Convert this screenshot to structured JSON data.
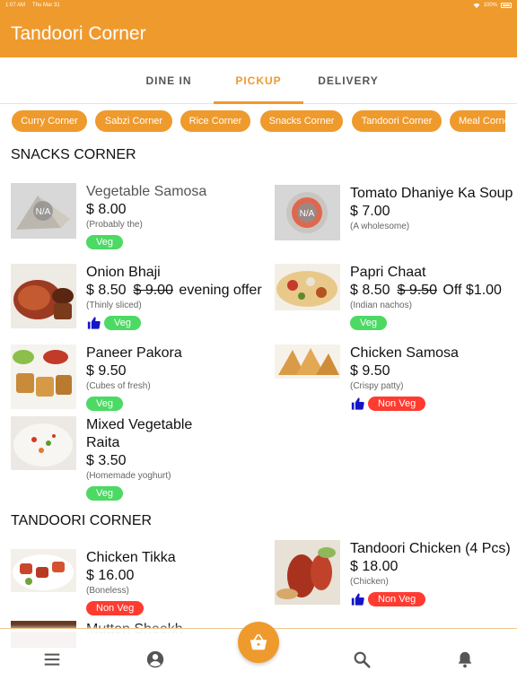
{
  "status_bar": {
    "time": "1:07 AM",
    "date": "Thu Mar 31",
    "battery": "100%"
  },
  "app": {
    "title": "Tandoori Corner"
  },
  "tabs": [
    {
      "label": "DINE IN",
      "active": false
    },
    {
      "label": "PICKUP",
      "active": true
    },
    {
      "label": "DELIVERY",
      "active": false
    }
  ],
  "categories": [
    "Curry Corner",
    "Sabzi Corner",
    "Rice Corner",
    "Snacks Corner",
    "Tandoori Corner",
    "Meal Corner"
  ],
  "sections": [
    {
      "title": "SNACKS CORNER",
      "items": [
        {
          "name": "Vegetable Samosa",
          "price": "$ 8.00",
          "desc": "(Probably the)",
          "tag": "Veg",
          "liked": false,
          "image": "na-placeholder"
        },
        {
          "name": "Tomato Dhaniye Ka Soup",
          "price": "$ 7.00",
          "desc": "(A wholesome)",
          "tag": "",
          "liked": false,
          "image": "na-placeholder"
        },
        {
          "name": "Onion Bhaji",
          "price": "$ 8.50",
          "old_price": "$ 9.00",
          "offer": "evening offer",
          "desc": "(Thinly sliced)",
          "tag": "Veg",
          "liked": true,
          "image": "onion-bhaji-photo"
        },
        {
          "name": "Papri Chaat",
          "price": "$ 8.50",
          "old_price": "$ 9.50",
          "offer": "Off $1.00",
          "desc": "(Indian nachos)",
          "tag": "Veg",
          "liked": false,
          "image": "papri-chaat-photo"
        },
        {
          "name": "Paneer Pakora",
          "price": "$ 9.50",
          "desc": "(Cubes of fresh)",
          "tag": "Veg",
          "liked": false,
          "image": "paneer-pakora-photo"
        },
        {
          "name": "Chicken Samosa",
          "price": "$ 9.50",
          "desc": "(Crispy patty)",
          "tag": "Non Veg",
          "liked": true,
          "image": "chicken-samosa-photo"
        },
        {
          "name": "Mixed Vegetable Raita",
          "price": "$ 3.50",
          "desc": "(Homemade yoghurt)",
          "tag": "Veg",
          "liked": false,
          "image": "raita-photo"
        }
      ]
    },
    {
      "title": "TANDOORI CORNER",
      "items": [
        {
          "name": "Chicken Tikka",
          "price": "$ 16.00",
          "desc": "(Boneless)",
          "tag": "Non Veg",
          "liked": false,
          "image": "chicken-tikka-photo"
        },
        {
          "name": "Tandoori Chicken (4 Pcs)",
          "price": "$ 18.00",
          "desc": "(Chicken)",
          "tag": "Non Veg",
          "liked": true,
          "image": "tandoori-chicken-photo"
        },
        {
          "name": "Mutton Sheekh",
          "image": "mutton-sheekh-photo"
        }
      ]
    }
  ],
  "placeholder_text": "N/A",
  "bottom_nav": [
    "menu-icon",
    "account-icon",
    "cart-basket-icon",
    "search-icon",
    "bell-icon"
  ],
  "colors": {
    "brand": "#ef9a2d",
    "veg": "#4cd964",
    "non_veg": "#ff3b30",
    "like": "#1515c8"
  }
}
